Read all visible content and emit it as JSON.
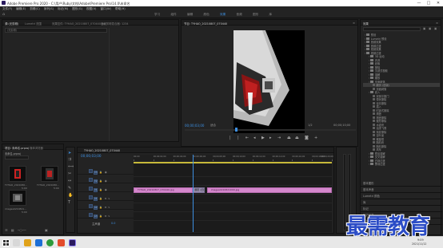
{
  "window": {
    "title": "Adobe Premiere Pro 2020 - C:\\用户\\Ruby\\文档\\Adobe\\Premiere Pro\\14.0\\未命名",
    "minimize": "—",
    "maximize": "□",
    "close": "✕"
  },
  "menu": [
    "文件(F)",
    "编辑(E)",
    "剪辑(C)",
    "序列(S)",
    "标记(M)",
    "图形(G)",
    "视图(V)",
    "窗口(W)",
    "帮助(H)"
  ],
  "workspaces": [
    "学习",
    "组件",
    "编辑",
    "颜色",
    "效果",
    "音频",
    "图形",
    "库"
  ],
  "active_workspace": "效果",
  "source_panel": {
    "tabs": [
      "源:(无剪辑)",
      "Lumetri 范围",
      "效果控件: TYHAO_20210807_070440.jpg",
      "音频剪辑混合器: 1234"
    ],
    "search_placeholder": "(无剪辑)"
  },
  "program": {
    "tab": "节目: TYHAO_20210807_070440",
    "timecode": "00;00;03;00",
    "fit": "适合",
    "quality": "1/2",
    "duration": "00;00;10;00",
    "playhead_fraction": 0.3
  },
  "project": {
    "tabs": [
      "项目: 未命名.prproj",
      "媒体浏览器"
    ],
    "path": "未命名.prproj",
    "items": [
      {
        "label": "TYHAO_2021080...",
        "duration": "5:00"
      },
      {
        "label": "TYHAO_2021080...",
        "duration": "5:00"
      },
      {
        "label": "images0210821...",
        "duration": "5:00"
      }
    ]
  },
  "timeline": {
    "tab": "TYHAO_20210807_070440",
    "timecode": "00;00;03;00",
    "ruler_labels": [
      "00;00",
      "00;00;02;00",
      "00;00;04;00",
      "00;00;06;00",
      "00;00;08;00",
      "00;00;10;00",
      "00;00;12;00",
      "00;00;14;00",
      "00;00;16;00",
      "00;00;18;00",
      "00;00;20;00"
    ],
    "video_tracks": [
      "V3",
      "V2",
      "V1"
    ],
    "audio_tracks": [
      "A1",
      "A2",
      "A3"
    ],
    "master": "主声道",
    "master_value": "0.0",
    "clips": [
      {
        "label": "TYHAO_20210807_070440.jpg",
        "start_fraction": 0.0,
        "end_fraction": 0.3
      },
      {
        "label": "翻页 (旧版)",
        "start_fraction": 0.3,
        "end_fraction": 0.36
      },
      {
        "label": "images0210821099.jpg",
        "start_fraction": 0.37,
        "end_fraction": 1.0
      }
    ],
    "playhead_fraction": 0.3
  },
  "effects": {
    "tab": "效果",
    "search_placeholder": "",
    "tree": [
      {
        "label": "预设",
        "indent": 0
      },
      {
        "label": "Lumetri 预设",
        "indent": 0
      },
      {
        "label": "音频效果",
        "indent": 0
      },
      {
        "label": "音频过渡",
        "indent": 0
      },
      {
        "label": "视频效果",
        "indent": 0
      },
      {
        "label": "视频过渡",
        "indent": 0
      },
      {
        "label": "3D 运动",
        "indent": 1
      },
      {
        "label": "内滑",
        "indent": 1
      },
      {
        "label": "划像",
        "indent": 1
      },
      {
        "label": "擦除",
        "indent": 1
      },
      {
        "label": "沉浸式视频",
        "indent": 1
      },
      {
        "label": "溶解",
        "indent": 1
      },
      {
        "label": "缩放",
        "indent": 1
      },
      {
        "label": "页面剥落",
        "indent": 1
      },
      {
        "label": "翻页 (旧版)",
        "indent": 2
      },
      {
        "label": "页面剥落",
        "indent": 2
      },
      {
        "label": "划入",
        "indent": 1
      },
      {
        "label": "双侧平推门",
        "indent": 2
      },
      {
        "label": "带状擦除",
        "indent": 2
      },
      {
        "label": "径向擦除",
        "indent": 2
      },
      {
        "label": "插入",
        "indent": 2
      },
      {
        "label": "时钟式擦除",
        "indent": 2
      },
      {
        "label": "棋盘",
        "indent": 2
      },
      {
        "label": "棋盘擦除",
        "indent": 2
      },
      {
        "label": "楔形擦除",
        "indent": 2
      },
      {
        "label": "水波块",
        "indent": 2
      },
      {
        "label": "油漆飞溅",
        "indent": 2
      },
      {
        "label": "渐变擦除",
        "indent": 2
      },
      {
        "label": "百叶窗",
        "indent": 2
      },
      {
        "label": "螺旋框",
        "indent": 2
      },
      {
        "label": "随机块",
        "indent": 2
      },
      {
        "label": "随机擦除",
        "indent": 2
      },
      {
        "label": "风车",
        "indent": 2
      },
      {
        "label": "叠加溶解",
        "indent": 1
      },
      {
        "label": "交叉溶解",
        "indent": 1
      },
      {
        "label": "白场过渡",
        "indent": 1
      },
      {
        "label": "黑场过渡",
        "indent": 1
      }
    ],
    "bottom_sections": [
      "基本图形",
      "基本声音",
      "Lumetri 颜色",
      "库",
      "标记",
      "历史记录",
      "信息"
    ]
  },
  "taskbar": {
    "time": "9:09",
    "date": "2021/11/12"
  },
  "watermark": "最需教育",
  "colors": {
    "accent": "#3d8fe0",
    "clip": "#d487cc",
    "timecode": "#3d8fe0",
    "watermark": "#2b4cc6"
  }
}
